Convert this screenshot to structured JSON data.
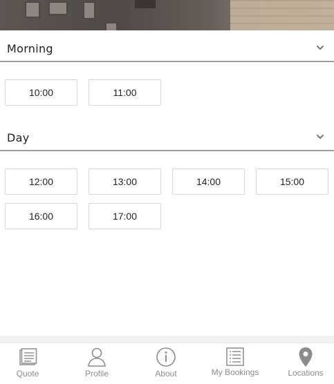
{
  "sections": [
    {
      "title": "Morning",
      "slots": [
        "10:00",
        "11:00"
      ]
    },
    {
      "title": "Day",
      "slots": [
        "12:00",
        "13:00",
        "14:00",
        "15:00",
        "16:00",
        "17:00"
      ]
    }
  ],
  "tabs": [
    {
      "label": "Quote",
      "icon": "quote-document-icon"
    },
    {
      "label": "Profile",
      "icon": "person-icon"
    },
    {
      "label": "About",
      "icon": "info-circle-icon"
    },
    {
      "label": "My Bookings",
      "icon": "list-icon"
    },
    {
      "label": "Locations",
      "icon": "map-pin-icon"
    }
  ],
  "colors": {
    "divider": "#9e9e9e",
    "slot_border": "#d6d6d6",
    "tab_icon": "#8c8c8c"
  }
}
